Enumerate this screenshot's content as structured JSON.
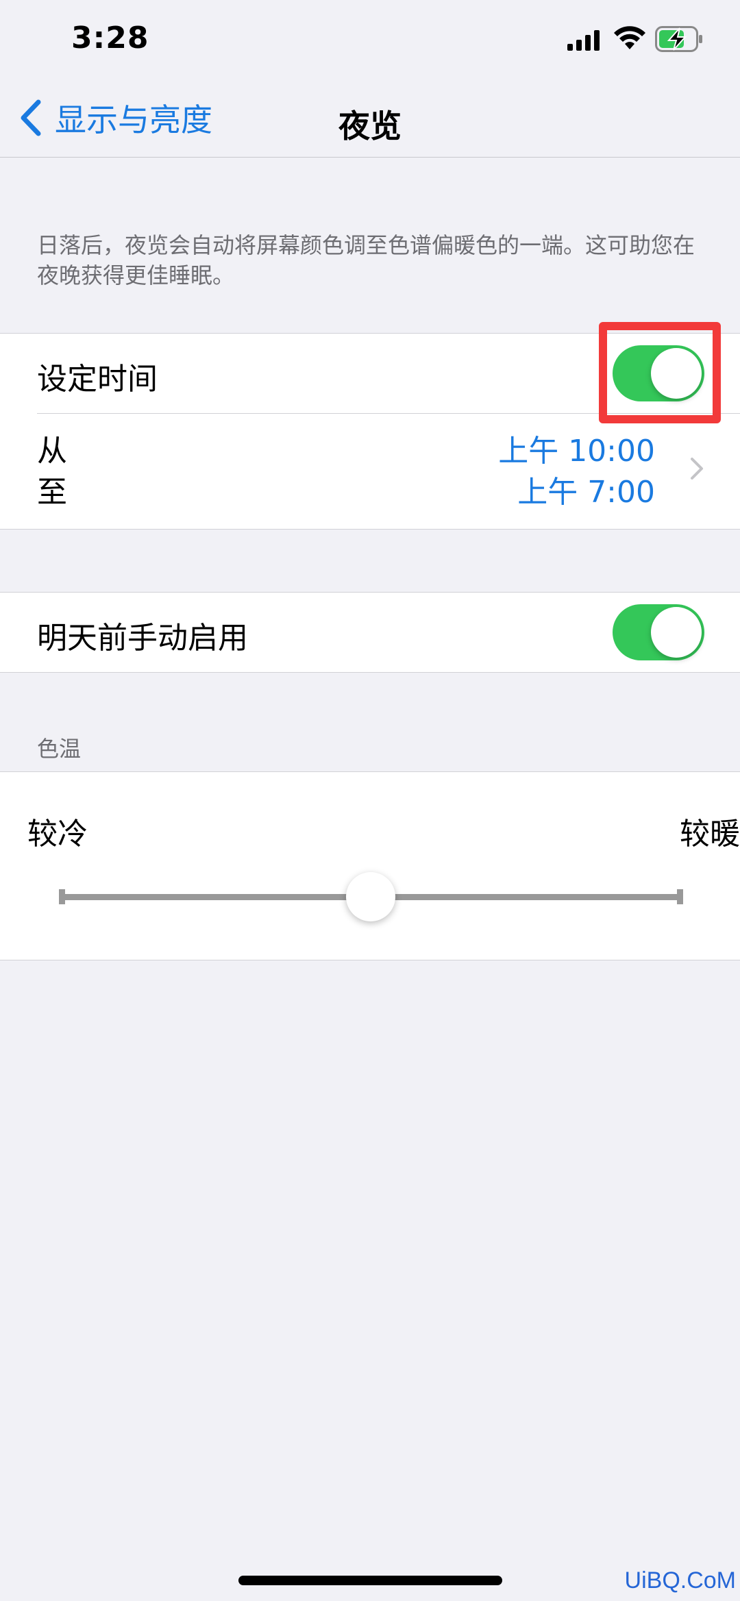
{
  "status_bar": {
    "time": "3:28",
    "icons": [
      "signal-icon",
      "wifi-icon",
      "battery-charging-icon"
    ]
  },
  "nav": {
    "back_label": "显示与亮度",
    "back_icon": "chevron-left-icon",
    "title": "夜览"
  },
  "description": "日落后，夜览会自动将屏幕颜色调至色谱偏暖色的一端。这可助您在夜晚获得更佳睡眠。",
  "schedule": {
    "label": "设定时间",
    "toggle_on": true,
    "from_label": "从",
    "to_label": "至",
    "from_value": "上午 10:00",
    "to_value": "上午 7:00",
    "highlight_color": "#f23a3a"
  },
  "manual": {
    "label": "明天前手动启用",
    "toggle_on": true
  },
  "color_temp": {
    "header": "色温",
    "left_label": "较冷",
    "right_label": "较暖",
    "value": 0.5
  },
  "watermark": "UiBQ.CoM",
  "colors": {
    "accent": "#1a7ae0",
    "toggle_on": "#34c759",
    "background": "#f1f1f6"
  }
}
